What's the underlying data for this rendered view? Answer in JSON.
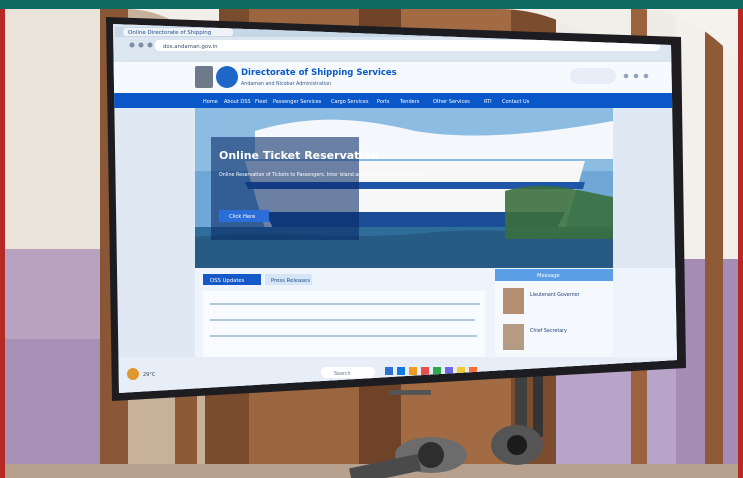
{
  "colors": {
    "teal_header": "#0d6b62",
    "red_border": "#b52a24",
    "screen_blue": "#0a57c9",
    "sky_blue": "#6fa8d6"
  },
  "browser": {
    "tab_label": "Online Directorate of Shipping",
    "address_value": "dos.andaman.gov.in"
  },
  "site": {
    "title": "Directorate of Shipping Services",
    "subtitle": "Andaman and Nicobar Administration",
    "nav_items": [
      "Home",
      "About DSS",
      "Fleet",
      "Passenger Services",
      "Cargo Services",
      "Ports",
      "Tenders",
      "Other Services",
      "RTI",
      "Contact Us"
    ],
    "hero_heading": "Online Ticket Reservation",
    "hero_text": "Online Reservation of Tickets to Passengers, Inter island and Mainland sector vessels",
    "hero_button": "Click Here",
    "tabs": [
      "DSS Updates",
      "Press Releases"
    ],
    "side_header": "Message",
    "side_name_1": "Lieutenant Governor",
    "side_name_2": "Chief Secretary"
  },
  "taskbar": {
    "search_label": "Search",
    "weather": "29°C"
  }
}
